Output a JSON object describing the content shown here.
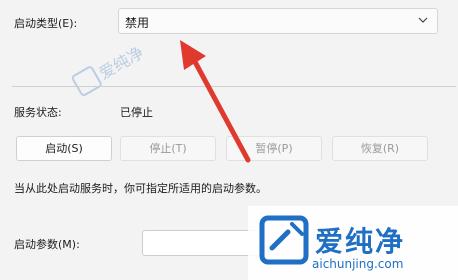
{
  "startup_type": {
    "label": "启动类型(E):",
    "value": "禁用"
  },
  "service_status": {
    "label": "服务状态:",
    "value": "已停止"
  },
  "buttons": {
    "start": "启动(S)",
    "stop": "停止(T)",
    "pause": "暂停(P)",
    "resume": "恢复(R)"
  },
  "hint": "当从此处启动服务时，你可指定所适用的启动参数。",
  "start_params": {
    "label": "启动参数(M):",
    "value": ""
  },
  "watermark": {
    "text_cn": "爱纯净",
    "url": "aichunjing.com",
    "faint_text": "爱纯净"
  },
  "colors": {
    "arrow": "#e03a2f",
    "watermark_blue": "#1f6fc4"
  }
}
